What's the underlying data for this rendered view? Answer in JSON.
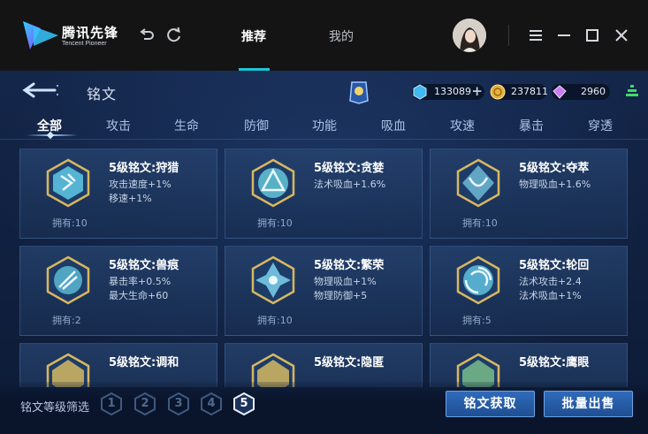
{
  "launcher": {
    "brand_cn": "腾讯先锋",
    "brand_en": "Tencent Pioneer",
    "tabs": [
      {
        "label": "推荐",
        "active": true
      },
      {
        "label": "我的",
        "active": false
      }
    ],
    "icons": {
      "back": "undo-icon",
      "refresh": "refresh-icon",
      "menu": "menu-icon",
      "minimize": "minimize-icon",
      "maximize": "maximize-icon",
      "close": "close-icon"
    }
  },
  "game": {
    "title": "铭文",
    "currencies": [
      {
        "name": "diamond",
        "value": "133089",
        "has_plus": true,
        "color": "#41b8f0"
      },
      {
        "name": "gold-coin",
        "value": "237811",
        "has_plus": false,
        "color": "#e5b23f"
      },
      {
        "name": "crystal",
        "value": "2960",
        "has_plus": false,
        "color": "#c77ef0"
      }
    ],
    "categories": [
      "全部",
      "攻击",
      "生命",
      "防御",
      "功能",
      "吸血",
      "攻速",
      "暴击",
      "穿透"
    ],
    "active_category": "全部",
    "inscriptions": [
      {
        "title": "5级铭文:狩猎",
        "attrs": [
          "攻击速度+1%",
          "移速+1%"
        ],
        "owned": "拥有:10",
        "color": "#5fc8e6"
      },
      {
        "title": "5级铭文:贪婪",
        "attrs": [
          "法术吸血+1.6%"
        ],
        "owned": "拥有:10",
        "color": "#63c5d8"
      },
      {
        "title": "5级铭文:夺萃",
        "attrs": [
          "物理吸血+1.6%"
        ],
        "owned": "拥有:10",
        "color": "#6fb9d6"
      },
      {
        "title": "5级铭文:兽痕",
        "attrs": [
          "暴击率+0.5%",
          "最大生命+60"
        ],
        "owned": "拥有:2",
        "color": "#5ab6d2"
      },
      {
        "title": "5级铭文:繁荣",
        "attrs": [
          "物理吸血+1%",
          "物理防御+5"
        ],
        "owned": "拥有:10",
        "color": "#77c9e6"
      },
      {
        "title": "5级铭文:轮回",
        "attrs": [
          "法术攻击+2.4",
          "法术吸血+1%"
        ],
        "owned": "拥有:5",
        "color": "#5fc0df"
      },
      {
        "title": "5级铭文:调和",
        "attrs": [],
        "owned": "",
        "color": "#e0c060"
      },
      {
        "title": "5级铭文:隐匿",
        "attrs": [],
        "owned": "",
        "color": "#e0c060"
      },
      {
        "title": "5级铭文:鹰眼",
        "attrs": [],
        "owned": "",
        "color": "#7ec48a"
      }
    ],
    "filter_label": "铭文等级筛选",
    "levels": [
      "1",
      "2",
      "3",
      "4",
      "5"
    ],
    "active_level": "5",
    "buttons": {
      "obtain": "铭文获取",
      "bulk_sell": "批量出售"
    }
  }
}
